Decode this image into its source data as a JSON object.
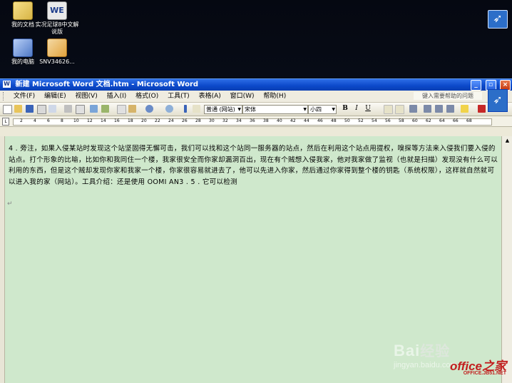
{
  "desktop": {
    "icons": [
      {
        "label": "我的文档",
        "icon": "folder-documents-icon"
      },
      {
        "label": "实况足球8中文解说版",
        "icon": "game-shortcut-icon",
        "glyph": "WE"
      },
      {
        "label": "我的电脑",
        "icon": "computer-icon"
      },
      {
        "label": "SNV34626...",
        "icon": "image-file-icon"
      }
    ]
  },
  "window": {
    "title": "新建 Microsoft Word 文档.htm - Microsoft Word",
    "buttons": {
      "minimize": "_",
      "restore": "▫",
      "close": "×"
    }
  },
  "menu": {
    "items": [
      "文件(F)",
      "编辑(E)",
      "视图(V)",
      "插入(I)",
      "格式(O)",
      "工具(T)",
      "表格(A)",
      "窗口(W)",
      "帮助(H)"
    ],
    "help_placeholder": "键入需要帮助的问题"
  },
  "toolbar": {
    "style": "普通 (网站)",
    "font": "宋体",
    "size": "小四",
    "bold": "B",
    "italic": "I",
    "underline": "U"
  },
  "ruler": {
    "marks": [
      "2",
      "4",
      "6",
      "8",
      "10",
      "12",
      "14",
      "16",
      "18",
      "20",
      "22",
      "24",
      "26",
      "28",
      "30",
      "32",
      "34",
      "36",
      "38",
      "40",
      "42",
      "44",
      "46",
      "48",
      "50",
      "52",
      "54",
      "56",
      "58",
      "60",
      "62",
      "64",
      "66",
      "68"
    ]
  },
  "document": {
    "text": "4 . 旁注，如果入侵某站时发现这个站坚固得无懈可击，我们可以找和这个站同一服务器的站点，然后在利用这个站点用提权，嗅探等方法来入侵我们要入侵的站点。打个形象的比喻，比如你和我同住一个楼，我家很安全而你家却漏洞百出，现在有个贼想入侵我家，他对我家做了监视（也就是扫描）发现没有什么可以利用的东西，但是这个贼却发现你家和我家一个楼，你家很容易就进去了，他可以先进入你家，然后通过你家得到整个楼的钥匙（系统权限），这样就自然就可以进入我的家（网站）。工具介绍：还是使用 OOMI AN3 . 5 . 它可以检测"
  },
  "watermarks": {
    "baidu": "Bai",
    "baidu_suffix": "经验",
    "jingyan": "jingyan.baidu.com",
    "office": "office之家",
    "office_url": "OFFICE.JB51.NET"
  }
}
